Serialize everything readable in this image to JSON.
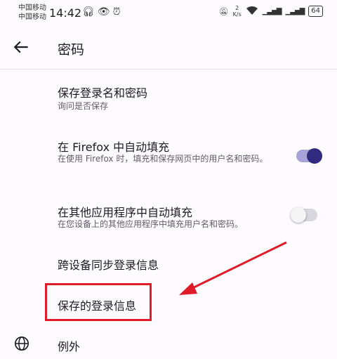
{
  "status_bar": {
    "carrier1": "中国移动",
    "carrier2": "中国移动",
    "time": "14:42",
    "net_rate_value": "2",
    "net_rate_unit": "K/s",
    "battery": "64"
  },
  "app_bar": {
    "title": "密码"
  },
  "prefs": {
    "save_logins": {
      "title": "保存登录名和密码",
      "subtitle": "询问是否保存"
    },
    "autofill_firefox": {
      "title": "在 Firefox 中自动填充",
      "subtitle": "在使用 Firefox 时，填充和保存网页中的用户名和密码。",
      "enabled": true
    },
    "autofill_other_apps": {
      "title": "在其他应用程序中自动填充",
      "subtitle": "在您设备上的其他应用程序中填充用户名和密码。",
      "enabled": false
    },
    "sync_logins": {
      "title": "跨设备同步登录信息"
    },
    "saved_logins": {
      "title": "保存的登录信息"
    },
    "exceptions": {
      "title": "例外"
    }
  },
  "colors": {
    "toggle_on_track": "#a7a3d9",
    "toggle_on_thumb": "#312a7e",
    "toggle_off_track": "#d9d7de",
    "toggle_off_thumb": "#f5f5f5",
    "highlight": "#e01b2a"
  }
}
